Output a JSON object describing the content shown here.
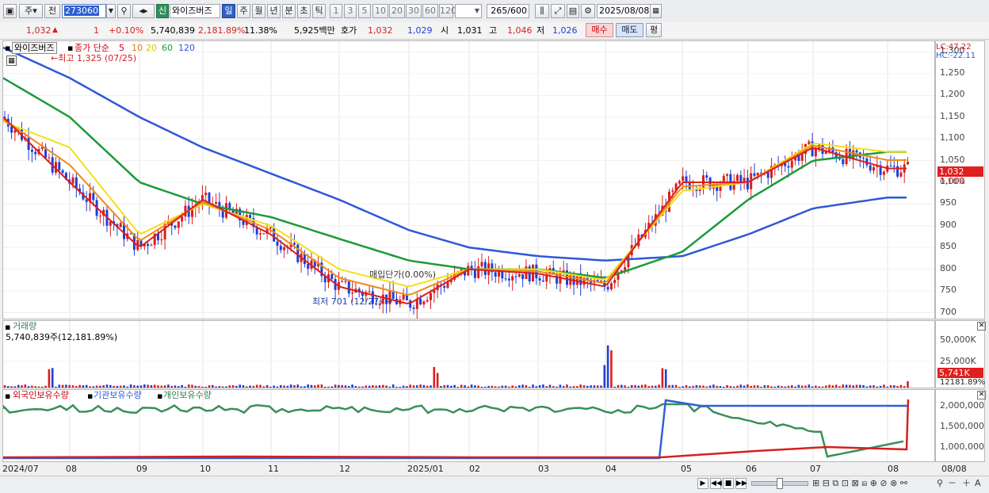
{
  "toolbar": {
    "type_label": "주",
    "type2_label": "전",
    "stock_code": "273060",
    "badge": "신",
    "stock_name": "와이즈버즈",
    "periods": [
      "일",
      "주",
      "월",
      "년",
      "분",
      "초",
      "틱"
    ],
    "active_period": "일",
    "intervals": [
      "1",
      "3",
      "5",
      "10",
      "20",
      "30",
      "60",
      "120"
    ],
    "count": "265",
    "count_total": "/600",
    "date": "2025/08/08"
  },
  "info": {
    "price": "1,032",
    "change": "1",
    "change_pct": "+0.10%",
    "volume": "5,740,839",
    "volume_pct": "2,181.89%",
    "turnover": "11.38%",
    "amount": "5,925백만",
    "ask_label": "호가",
    "ask": "1,032",
    "bid": "1,029",
    "open_label": "시",
    "open": "1,031",
    "high_label": "고",
    "high": "1,046",
    "low_label": "저",
    "low": "1,026",
    "buy_label": "매수",
    "sell_label": "매도",
    "eval_label": "평"
  },
  "main_chart": {
    "name_tab": "와이즈버즈",
    "legend_prefix": "종가 단순",
    "ma_periods": [
      "5",
      "10",
      "20",
      "60",
      "120"
    ],
    "high_note": "최고 1,325 (07/25)",
    "low_note": "최저 701 (12/27)",
    "avg_note": "매입단가(0.00%)",
    "lc": "LC:47.22",
    "hc": "HC:-22.11",
    "price_box": "1,032",
    "pct_box": "0.10%",
    "y_ticks": [
      "1,300",
      "1,250",
      "1,200",
      "1,150",
      "1,100",
      "1,050",
      "1,000",
      "950",
      "900",
      "850",
      "800",
      "750",
      "700"
    ]
  },
  "volume_chart": {
    "title": "거래량",
    "value": "5,740,839주(12,181.89%)",
    "y_ticks": [
      "50,000K",
      "25,000K"
    ],
    "value_box": "5,741K",
    "pct_box": "12181.89%"
  },
  "holding_chart": {
    "legend": [
      "외국인보유수량",
      "기관보유수량",
      "개인보유수량"
    ],
    "y_ticks": [
      "2,000,000",
      "1,500,000",
      "1,000,000"
    ]
  },
  "x_axis": [
    "2024/07",
    "08",
    "09",
    "10",
    "11",
    "12",
    "2025/01",
    "02",
    "03",
    "04",
    "05",
    "06",
    "07",
    "08",
    "08/08"
  ],
  "colors": {
    "ma5": "#d81f1f",
    "ma10": "#f08a1a",
    "ma20": "#f2e01a",
    "ma60": "#1d9a3a",
    "ma120": "#2f58d8",
    "up": "#d81f1f",
    "down": "#1f3fd8",
    "foreign": "#2f62d6",
    "institution": "#d81f1f",
    "individual": "#3a8f5a"
  },
  "chart_data": {
    "type": "line",
    "title": "",
    "ylabel": "",
    "ylim": [
      690,
      1310
    ],
    "x": [
      "2024/07",
      "08",
      "09",
      "10",
      "11",
      "12",
      "2025/01",
      "02",
      "03",
      "04",
      "05",
      "06",
      "07",
      "08"
    ],
    "series": [
      {
        "name": "5",
        "values": [
          1150,
          1000,
          850,
          960,
          880,
          760,
          720,
          800,
          790,
          760,
          1000,
          1000,
          1080,
          1032
        ]
      },
      {
        "name": "20",
        "values": [
          1140,
          1080,
          880,
          950,
          900,
          800,
          760,
          800,
          800,
          775,
          980,
          1000,
          1090,
          1070
        ]
      },
      {
        "name": "60",
        "values": [
          1240,
          1150,
          1000,
          950,
          920,
          870,
          820,
          800,
          800,
          780,
          840,
          960,
          1050,
          1070
        ]
      },
      {
        "name": "120",
        "values": [
          1310,
          1240,
          1150,
          1080,
          1020,
          960,
          890,
          850,
          830,
          820,
          830,
          880,
          940,
          965
        ]
      }
    ],
    "annotations": [
      {
        "text": "최고 1,325 (07/25)",
        "x": "2024/07",
        "y": 1325
      },
      {
        "text": "최저 701 (12/27)",
        "x": "12",
        "y": 701
      }
    ]
  }
}
